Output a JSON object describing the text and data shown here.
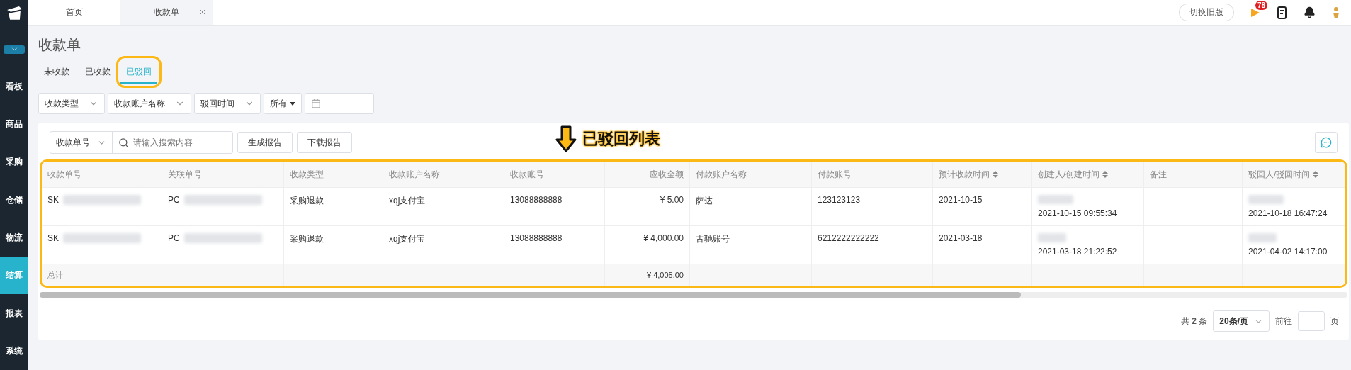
{
  "sidebar": {
    "items": [
      {
        "label": "看板",
        "selected": false
      },
      {
        "label": "商品",
        "selected": false
      },
      {
        "label": "采购",
        "selected": false
      },
      {
        "label": "仓储",
        "selected": false
      },
      {
        "label": "物流",
        "selected": false
      },
      {
        "label": "结算",
        "selected": true
      },
      {
        "label": "报表",
        "selected": false
      },
      {
        "label": "系统",
        "selected": false
      }
    ]
  },
  "top_tabs": [
    {
      "label": "首页",
      "selected": false,
      "closable": false
    },
    {
      "label": "收款单",
      "selected": true,
      "closable": true
    }
  ],
  "header": {
    "switch_button": "切换旧版",
    "badge": "78"
  },
  "page_title": "收款单",
  "tabs": [
    {
      "label": "未收款",
      "selected": false,
      "highlighted": false
    },
    {
      "label": "已收款",
      "selected": false,
      "highlighted": false
    },
    {
      "label": "已驳回",
      "selected": true,
      "highlighted": true
    }
  ],
  "filters": [
    {
      "kind": "select",
      "label": "收款类型"
    },
    {
      "kind": "select",
      "label": "收款账户名称"
    },
    {
      "kind": "select",
      "label": "驳回时间"
    },
    {
      "kind": "menu",
      "label": "所有"
    },
    {
      "kind": "date",
      "label": "一"
    }
  ],
  "toolbar": {
    "search_type": "收款单号",
    "placeholder": "请输入搜索内容",
    "buttons": [
      "生成报告",
      "下载报告"
    ]
  },
  "callout": {
    "text": "已驳回列表"
  },
  "table": {
    "highlighted": true,
    "columns": [
      {
        "label": "收款单号",
        "sortable": false,
        "kind": "text"
      },
      {
        "label": "关联单号",
        "sortable": false,
        "kind": "text"
      },
      {
        "label": "收款类型",
        "sortable": false,
        "kind": "text"
      },
      {
        "label": "收款账户名称",
        "sortable": false,
        "kind": "text"
      },
      {
        "label": "收款账号",
        "sortable": false,
        "kind": "text"
      },
      {
        "label": "应收金额",
        "sortable": false,
        "kind": "money"
      },
      {
        "label": "付款账户名称",
        "sortable": false,
        "kind": "text"
      },
      {
        "label": "付款账号",
        "sortable": false,
        "kind": "text"
      },
      {
        "label": "预计收款时间",
        "sortable": true,
        "kind": "text"
      },
      {
        "label": "创建人/创建时间",
        "sortable": true,
        "kind": "text"
      },
      {
        "label": "备注",
        "sortable": false,
        "kind": "text"
      },
      {
        "label": "驳回人/驳回时间",
        "sortable": true,
        "kind": "text"
      }
    ],
    "rows": [
      {
        "cells": [
          {
            "text": "SK",
            "blurred": true
          },
          {
            "text": "PC",
            "blurred": true
          },
          {
            "text": "采购退款"
          },
          {
            "text": "xqj支付宝"
          },
          {
            "text": "13088888888"
          },
          {
            "text": "¥ 5.00"
          },
          {
            "text": "萨达"
          },
          {
            "text": "123123123"
          },
          {
            "text": "2021-10-15"
          },
          {
            "text": "2021-10-15 09:55:34",
            "blurred": true
          },
          {
            "text": ""
          },
          {
            "text": "2021-10-18 16:47:24",
            "blurred": true
          }
        ]
      },
      {
        "cells": [
          {
            "text": "SK",
            "blurred": true
          },
          {
            "text": "PC",
            "blurred": true
          },
          {
            "text": "采购退款"
          },
          {
            "text": "xqj支付宝"
          },
          {
            "text": "13088888888"
          },
          {
            "text": "¥ 4,000.00"
          },
          {
            "text": "古驰账号"
          },
          {
            "text": "6212222222222"
          },
          {
            "text": "2021-03-18"
          },
          {
            "text": "2021-03-18 21:22:52",
            "blurred": true
          },
          {
            "text": ""
          },
          {
            "text": "2021-04-02 14:17:00",
            "blurred": true
          }
        ]
      }
    ],
    "total": {
      "label": "总计",
      "amount": "¥ 4,005.00"
    }
  },
  "pagination": {
    "total_prefix": "共",
    "total": "2",
    "total_suffix": "条",
    "page_size": "20条/页",
    "goto": "前往",
    "page_suffix": "页"
  }
}
